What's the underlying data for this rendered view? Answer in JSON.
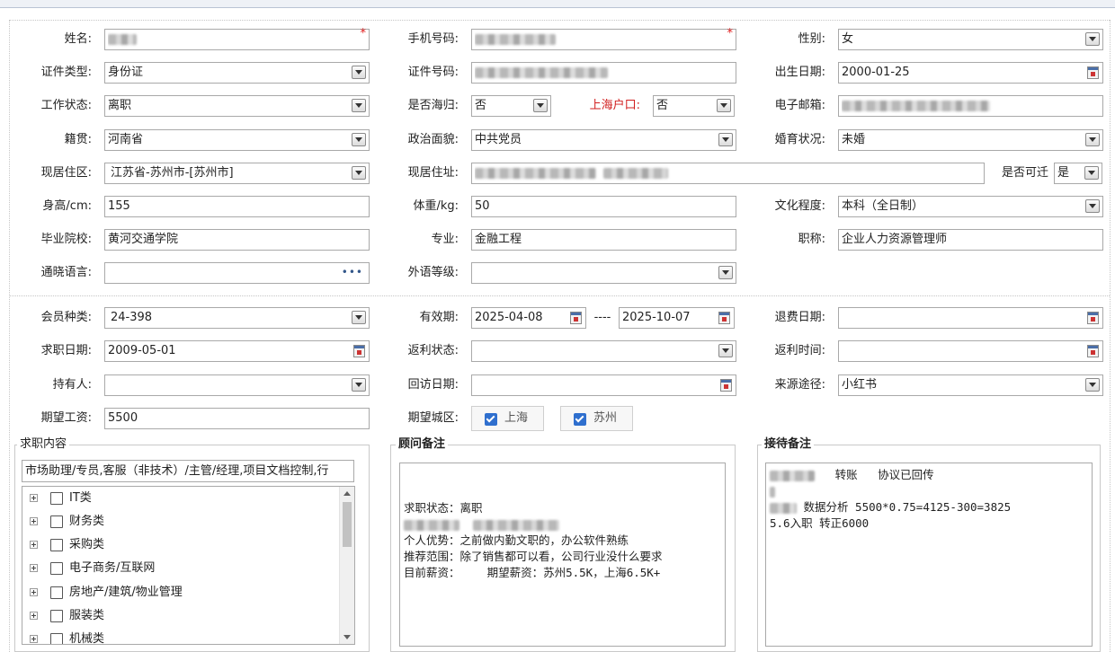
{
  "personal": {
    "name": {
      "label": "姓名:"
    },
    "mobile": {
      "label": "手机号码:"
    },
    "gender": {
      "label": "性别:",
      "value": "女"
    },
    "id_type": {
      "label": "证件类型:",
      "value": "身份证"
    },
    "id_number": {
      "label": "证件号码:"
    },
    "birth_date": {
      "label": "出生日期:",
      "value": "2000-01-25"
    },
    "work_status": {
      "label": "工作状态:",
      "value": "离职"
    },
    "returnee": {
      "label": "是否海归:",
      "value": "否"
    },
    "shanghai_hukou": {
      "label": "上海户口:",
      "value": "否"
    },
    "email": {
      "label": "电子邮箱:"
    },
    "native_place": {
      "label": "籍贯:",
      "value": "河南省"
    },
    "political": {
      "label": "政治面貌:",
      "value": "中共党员"
    },
    "marital": {
      "label": "婚育状况:",
      "value": "未婚"
    },
    "residence_area": {
      "label": "现居住区:",
      "value": "江苏省-苏州市-[苏州市]"
    },
    "residence_address": {
      "label": "现居住址:"
    },
    "relocate": {
      "label": "是否可迁",
      "value": "是"
    },
    "height": {
      "label": "身高/cm:",
      "value": "155"
    },
    "weight": {
      "label": "体重/kg:",
      "value": "50"
    },
    "education": {
      "label": "文化程度:",
      "value": "本科（全日制）"
    },
    "school": {
      "label": "毕业院校:",
      "value": "黄河交通学院"
    },
    "major": {
      "label": "专业:",
      "value": "金融工程"
    },
    "title": {
      "label": "职称:",
      "value": "企业人力资源管理师"
    },
    "languages": {
      "label": "通晓语言:",
      "value": ""
    },
    "foreign_level": {
      "label": "外语等级:",
      "value": ""
    }
  },
  "membership": {
    "member_type": {
      "label": "会员种类:",
      "value": "24-398"
    },
    "valid_period": {
      "label": "有效期:",
      "start": "2025-04-08",
      "sep": "----",
      "end": "2025-10-07"
    },
    "refund_date": {
      "label": "退费日期:",
      "value": ""
    },
    "job_search_date": {
      "label": "求职日期:",
      "value": "2009-05-01"
    },
    "rebate_status": {
      "label": "返利状态:",
      "value": ""
    },
    "rebate_time": {
      "label": "返利时间:",
      "value": ""
    },
    "holder": {
      "label": "持有人:",
      "value": ""
    },
    "visit_date": {
      "label": "回访日期:",
      "value": ""
    },
    "source": {
      "label": "来源途径:",
      "value": "小红书"
    },
    "expected_salary": {
      "label": "期望工资:",
      "value": "5500"
    },
    "expected_city": {
      "label": "期望城区:",
      "options": [
        {
          "label": "上海",
          "checked": true
        },
        {
          "label": "苏州",
          "checked": true
        }
      ]
    }
  },
  "job_content": {
    "legend": "求职内容",
    "summary": "市场助理/专员,客服（非技术）/主管/经理,项目文档控制,行",
    "categories": [
      "IT类",
      "财务类",
      "采购类",
      "电子商务/互联网",
      "房地产/建筑/物业管理",
      "服装类",
      "机械类"
    ]
  },
  "consultant_notes": {
    "legend": "顾问备注",
    "lines": [
      "求职状态：离职",
      "",
      "个人优势：之前做内勤文职的，办公软件熟练",
      "推荐范围：除了销售都可以看，公司行业没什么要求",
      "目前薪资：    期望薪资：苏州5.5K，上海6.5K+"
    ]
  },
  "reception_notes": {
    "legend": "接待备注",
    "lines": [
      "转账   协议已回传",
      "",
      "数据分析 5500*0.75=4125-300=3825",
      "5.6入职 转正6000"
    ]
  },
  "colors": {
    "required_mark": "#e02020",
    "hukou_label": "#d11e1e",
    "checkbox": "#2f6fce"
  }
}
